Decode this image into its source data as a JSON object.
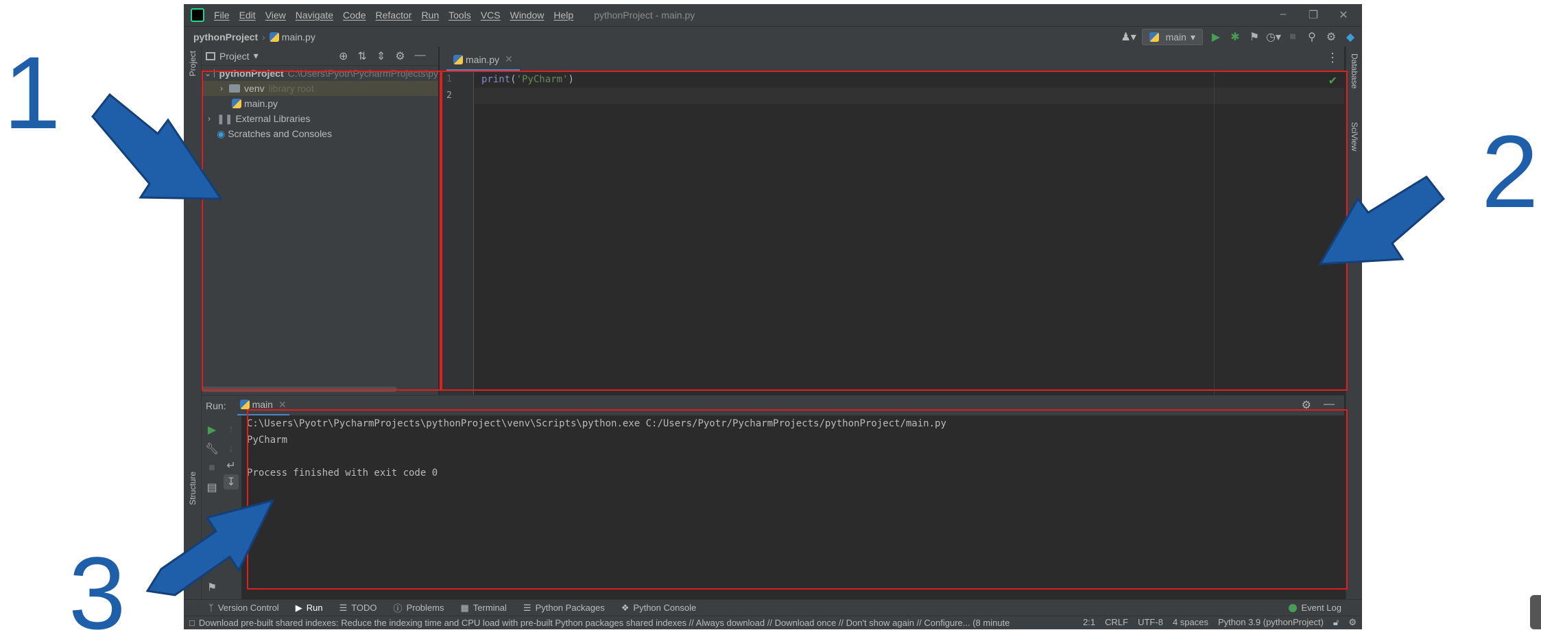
{
  "annotations": {
    "num1": "1",
    "num2": "2",
    "num3": "3"
  },
  "menu": {
    "items": [
      "File",
      "Edit",
      "View",
      "Navigate",
      "Code",
      "Refactor",
      "Run",
      "Tools",
      "VCS",
      "Window",
      "Help"
    ],
    "window_title": "pythonProject - main.py"
  },
  "navbar": {
    "project": "pythonProject",
    "file": "main.py",
    "run_config": "main"
  },
  "project_panel": {
    "title": "Project",
    "tree": [
      {
        "label": "pythonProject",
        "path": "C:\\Users\\Pyotr\\PycharmProjects\\py"
      },
      {
        "label": "venv",
        "path": "library root"
      },
      {
        "label": "main.py"
      },
      {
        "label": "External Libraries"
      },
      {
        "label": "Scratches and Consoles"
      }
    ]
  },
  "editor": {
    "tab": "main.py",
    "line_numbers": [
      "1",
      "2"
    ],
    "code": {
      "fn": "print",
      "open": "(",
      "str": "'PyCharm'",
      "close": ")"
    }
  },
  "run_panel": {
    "label": "Run:",
    "tab": "main",
    "console": [
      "C:\\Users\\Pyotr\\PycharmProjects\\pythonProject\\venv\\Scripts\\python.exe C:/Users/Pyotr/PycharmProjects/pythonProject/main.py",
      "PyCharm",
      "",
      "Process finished with exit code 0"
    ]
  },
  "side_stripes": {
    "left_top": "Project",
    "left_bottom": "Structure",
    "right_top": "Database",
    "right_bottom": "SciView"
  },
  "tool_windows": [
    "Version Control",
    "Run",
    "TODO",
    "Problems",
    "Terminal",
    "Python Packages",
    "Python Console"
  ],
  "event_log": "Event Log",
  "status": {
    "message": "Download pre-built shared indexes: Reduce the indexing time and CPU load with pre-built Python packages shared indexes // Always download // Download once // Don't show again // Configure... (8 minute",
    "position": "2:1",
    "line_sep": "CRLF",
    "encoding": "UTF-8",
    "indent": "4 spaces",
    "interpreter": "Python 3.9 (pythonProject)"
  },
  "colors": {
    "highlight": "#e02020",
    "arrow": "#1f5fa9",
    "accent": "#4a88c7"
  }
}
